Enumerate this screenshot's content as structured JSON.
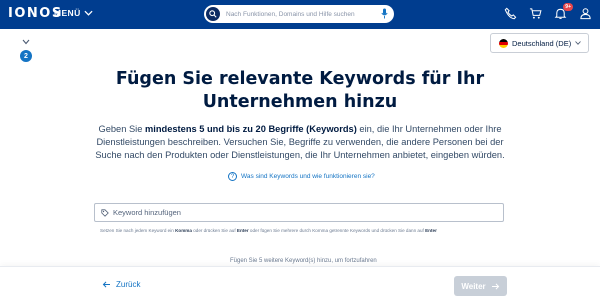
{
  "header": {
    "brand": "IONOS",
    "menu_label": "MENÜ",
    "search_placeholder": "Nach Funktionen, Domains und Hilfe suchen",
    "notification_count": "9+"
  },
  "stepper": {
    "current_step": "2"
  },
  "language": {
    "selected": "Deutschland (DE)"
  },
  "main": {
    "title": "Fügen Sie relevante Keywords für Ihr Unternehmen hinzu",
    "desc_pre": "Geben Sie ",
    "desc_bold": "mindestens 5 und bis zu 20 Begriffe (Keywords)",
    "desc_post": " ein, die Ihr Unternehmen oder Ihre Dienstleistungen beschreiben. Versuchen Sie, Begriffe zu verwenden, die andere Personen bei der Suche nach den Produkten oder Dienstleistungen, die Ihr Unternehmen anbietet, eingeben würden.",
    "help_link": "Was sind Keywords und wie funktionieren sie?",
    "keyword_placeholder": "Keyword hinzufügen",
    "hint_1": "Setzen Sie nach jedem Keyword ein ",
    "hint_b1": "Komma",
    "hint_2": " oder drücken Sie auf ",
    "hint_b2": "Enter",
    "hint_3": " oder fügen Sie mehrere durch Komma getrennte Keywords und drücken Sie dann auf ",
    "hint_b3": "Enter",
    "add_more": "Fügen Sie 5 weitere Keyword(s) hinzu, um fortzufahren"
  },
  "footer": {
    "back_label": "Zurück",
    "next_label": "Weiter"
  },
  "colors": {
    "header_bg": "#003d8f",
    "accent": "#1474c4",
    "disabled_button": "#c8cfd8"
  },
  "icons": [
    "search-icon",
    "microphone-icon",
    "phone-icon",
    "cart-icon",
    "bell-icon",
    "user-icon",
    "chevron-down-icon",
    "question-icon",
    "tag-icon",
    "arrow-left-icon",
    "arrow-right-icon"
  ]
}
